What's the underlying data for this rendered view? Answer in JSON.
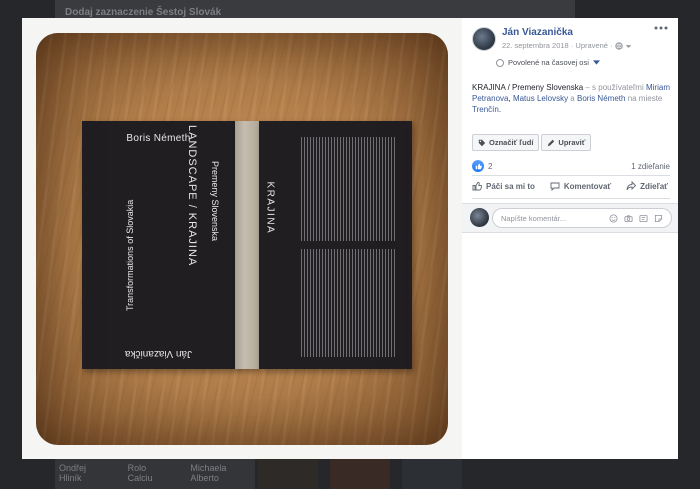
{
  "background": {
    "top_strip_text": "Dodaj zaznaczenie Šestoj Slovák",
    "bottom_labels": [
      "Ondřej Hliník",
      "Rolo Calciu",
      "Michaela Alberto"
    ]
  },
  "post": {
    "author": "Ján Viazanička",
    "date": "22. septembra 2018",
    "edited": "Upravené",
    "privacy_separator": "·",
    "timeline_label": "Povolené na časovej osi",
    "caption": {
      "title": "KRAJINA / Premeny Slovenska",
      "with_text": " – s používateľmi",
      "people": [
        "Miriam Petranova",
        "Matus Lelovsky",
        "Boris Németh"
      ],
      "comma": ",",
      "and_text": " a ",
      "place_text": "na mieste",
      "place": "Trenčín",
      "period": "."
    },
    "tag_button": "Označiť ľudí",
    "edit_button": "Upraviť",
    "like_count": "2",
    "share_count": "1 zdieľanie",
    "actions": {
      "like": "Páči sa mi to",
      "comment": "Komentovať",
      "share": "Zdieľať"
    },
    "comment_placeholder": "Napíšte komentár..."
  },
  "photo": {
    "cover_author_top": "Boris Németh",
    "cover_title_en": "Transformations of Slovakia",
    "cover_title_main": "LANDSCAPE / KRAJINA",
    "cover_title_sk": "Premeny Slovenska",
    "cover_author_bottom": "Ján Viazanička",
    "back_title": "KRAJINA"
  },
  "colors": {
    "link": "#385898",
    "accent": "#1877f2",
    "book": "#211e22"
  }
}
